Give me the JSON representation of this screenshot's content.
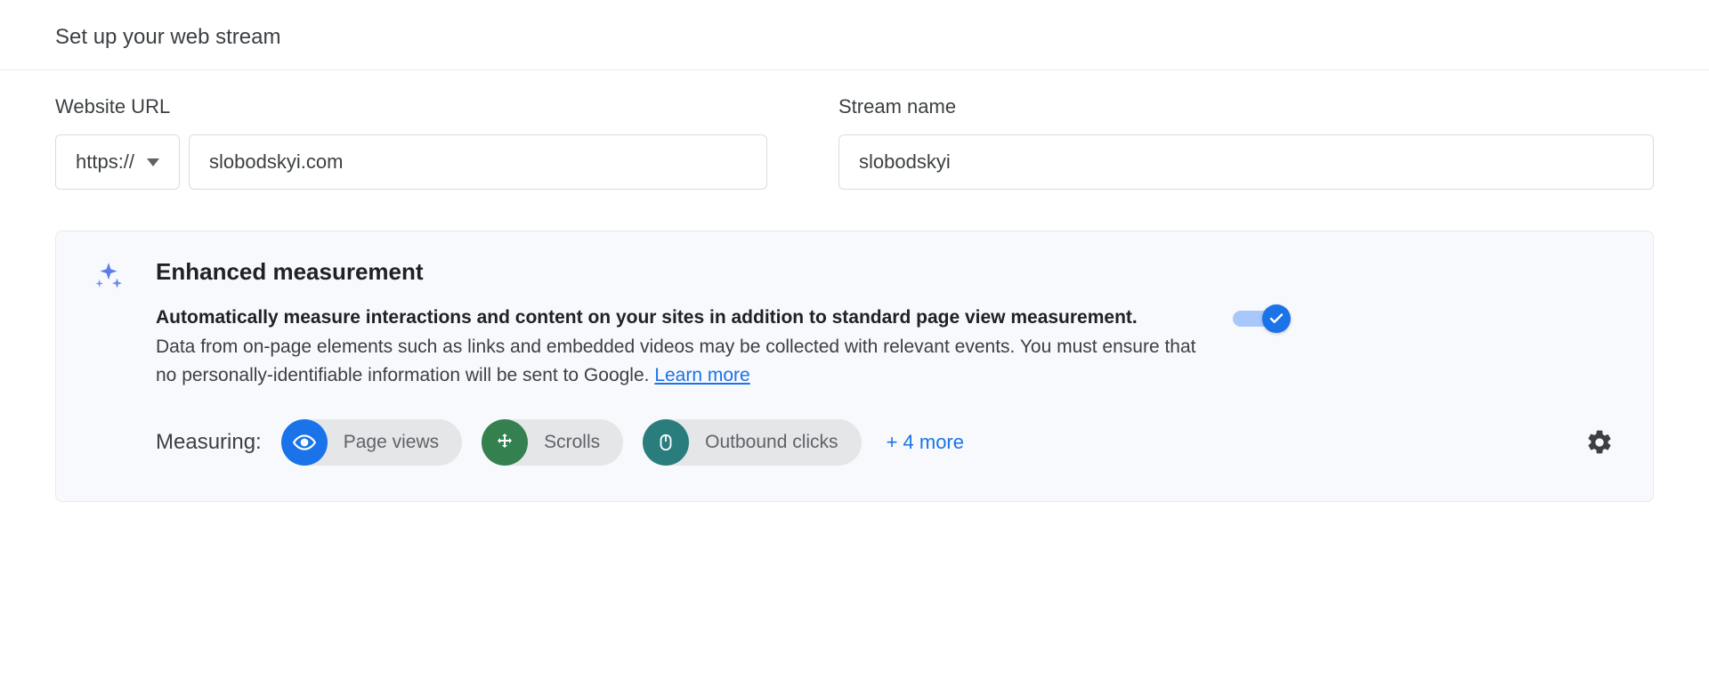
{
  "header": {
    "title": "Set up your web stream"
  },
  "form": {
    "website_url_label": "Website URL",
    "protocol": "https://",
    "url_value": "slobodskyi.com",
    "stream_name_label": "Stream name",
    "stream_name_value": "slobodskyi"
  },
  "enhanced": {
    "title": "Enhanced measurement",
    "desc_bold": "Automatically measure interactions and content on your sites in addition to standard page view measurement.",
    "desc_rest": "Data from on-page elements such as links and embedded videos may be collected with relevant events. You must ensure that no personally-identifiable information will be sent to Google. ",
    "learn_more": "Learn more",
    "measuring_label": "Measuring:",
    "chips": {
      "page_views": "Page views",
      "scrolls": "Scrolls",
      "outbound": "Outbound clicks"
    },
    "more": "+ 4 more"
  }
}
